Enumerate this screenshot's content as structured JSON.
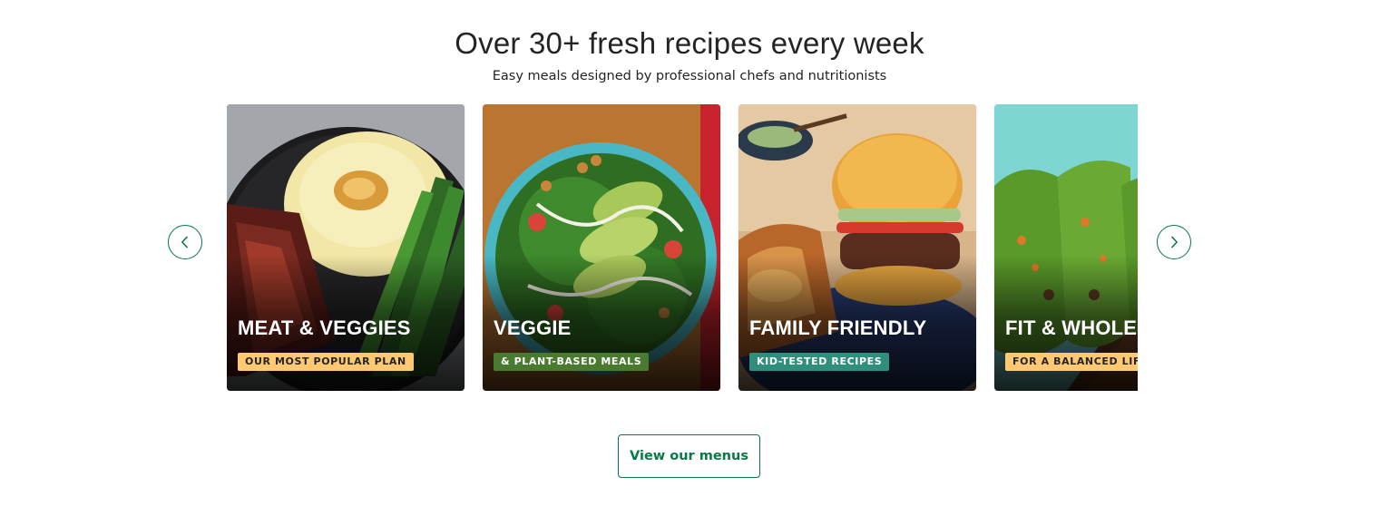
{
  "section": {
    "headline": "Over 30+ fresh recipes every week",
    "subheadline": "Easy meals designed by professional chefs and nutritionists"
  },
  "carousel": {
    "prev_icon": "chevron-left-icon",
    "next_icon": "chevron-right-icon",
    "cards": [
      {
        "title": "MEAT & VEGGIES",
        "badge": "OUR MOST POPULAR PLAN",
        "badge_color": "#ffc974"
      },
      {
        "title": "VEGGIE",
        "badge": "& PLANT-BASED MEALS",
        "badge_color": "#4a7a2f"
      },
      {
        "title": "FAMILY FRIENDLY",
        "badge": "KID-TESTED RECIPES",
        "badge_color": "#2f8f7c"
      },
      {
        "title": "FIT & WHOLESOME",
        "badge": "FOR A BALANCED LIFESTYLE",
        "badge_color": "#ffc974"
      }
    ]
  },
  "cta": {
    "label": "View our menus"
  },
  "colors": {
    "brand_green": "#067a46",
    "text": "#242424"
  }
}
